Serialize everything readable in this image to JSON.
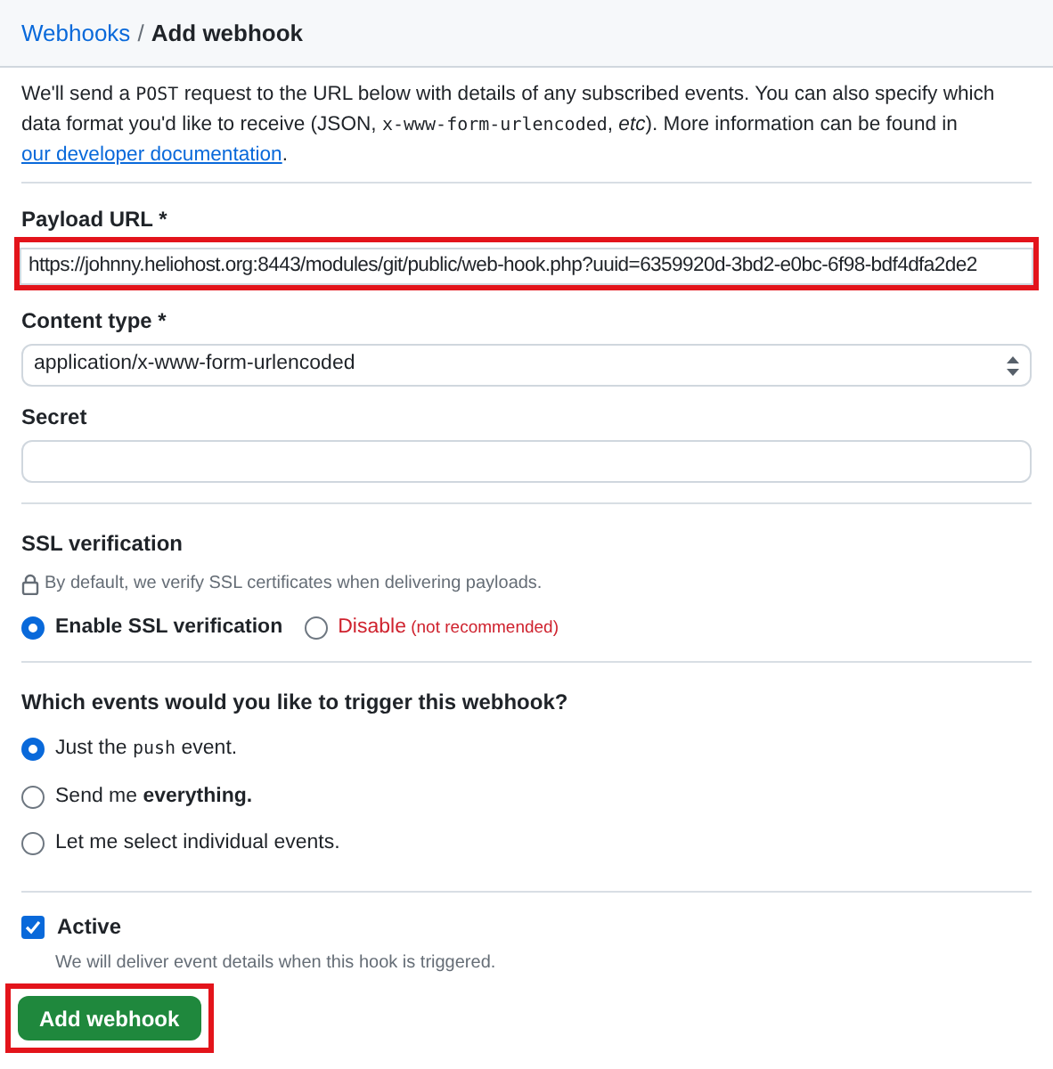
{
  "breadcrumb": {
    "parent": "Webhooks",
    "separator": "/",
    "current": "Add webhook"
  },
  "intro": [
    {
      "kind": "text",
      "text": "We'll send a "
    },
    {
      "kind": "code",
      "text": "POST"
    },
    {
      "kind": "text",
      "text": " request to the URL below with details of any subscribed events. You can also specify which data format you'd like to receive (JSON, "
    },
    {
      "kind": "code",
      "text": "x-www-form-urlencoded"
    },
    {
      "kind": "text",
      "text": ", "
    },
    {
      "kind": "italic",
      "text": "etc"
    },
    {
      "kind": "text",
      "text": "). More information can be found in "
    },
    {
      "kind": "link",
      "text": "our developer documentation"
    },
    {
      "kind": "text",
      "text": "."
    }
  ],
  "payload_url": {
    "label": "Payload URL *",
    "value": "https://johnny.heliohost.org:8443/modules/git/public/web-hook.php?uuid=6359920d-3bd2-e0bc-6f98-bdf4dfa2de2",
    "highlighted": true
  },
  "content_type": {
    "label": "Content type *",
    "value": "application/x-www-form-urlencoded"
  },
  "secret": {
    "label": "Secret"
  },
  "ssl": {
    "title": "SSL verification",
    "note": "By default, we verify SSL certificates when delivering payloads.",
    "options": [
      {
        "label": "Enable SSL verification",
        "selected": true,
        "kind": "normal"
      },
      {
        "label": "Disable",
        "hint": "(not recommended)",
        "selected": false,
        "kind": "danger"
      }
    ]
  },
  "events": {
    "question": "Which events would you like to trigger this webhook?",
    "options": [
      {
        "selected": true,
        "parts": [
          {
            "kind": "text",
            "text": "Just the "
          },
          {
            "kind": "code",
            "text": "push"
          },
          {
            "kind": "text",
            "text": " event."
          }
        ]
      },
      {
        "selected": false,
        "parts": [
          {
            "kind": "text",
            "text": "Send me "
          },
          {
            "kind": "bold",
            "text": "everything."
          }
        ]
      },
      {
        "selected": false,
        "parts": [
          {
            "kind": "text",
            "text": "Let me select individual events."
          }
        ]
      }
    ]
  },
  "active": {
    "label": "Active",
    "checked": true,
    "note": "We will deliver event details when this hook is triggered."
  },
  "submit": {
    "label": "Add webhook",
    "highlighted": true
  }
}
